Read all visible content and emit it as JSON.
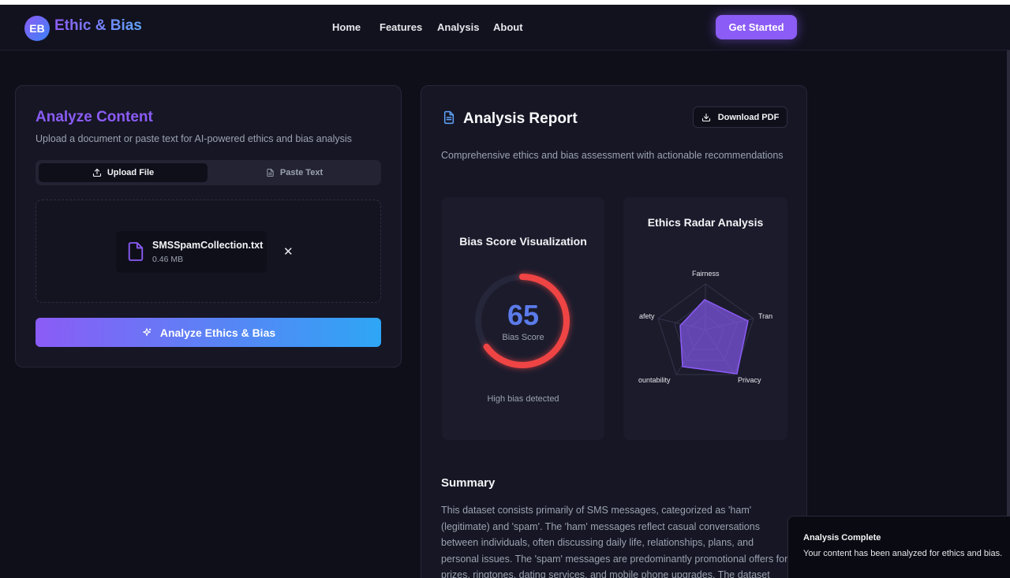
{
  "nav": {
    "logo_initials": "EB",
    "logo_text": "Ethic & Bias",
    "links": [
      "Home",
      "Features",
      "Analysis",
      "About"
    ],
    "cta": "Get Started"
  },
  "analyze": {
    "title": "Analyze Content",
    "subtitle": "Upload a document or paste text for AI-powered ethics and bias analysis",
    "tabs": [
      {
        "label": "Upload File",
        "icon": "upload-icon",
        "active": true
      },
      {
        "label": "Paste Text",
        "icon": "file-text-icon",
        "active": false
      }
    ],
    "file": {
      "name": "SMSSpamCollection.txt",
      "size": "0.46 MB",
      "remove_icon": "close-icon"
    },
    "button": "Analyze Ethics & Bias"
  },
  "report": {
    "title": "Analysis Report",
    "download": "Download PDF",
    "subtitle": "Comprehensive ethics and bias assessment with actionable recommendations",
    "bias": {
      "title": "Bias Score Visualization",
      "score": "65",
      "score_value": 65,
      "label": "Bias Score",
      "note": "High bias detected"
    },
    "radar": {
      "title": "Ethics Radar Analysis",
      "axes": [
        "Fairness",
        "Tran",
        "Privacy",
        "ountability",
        "afety"
      ]
    },
    "summary_title": "Summary",
    "summary": "This dataset consists primarily of SMS messages, categorized as 'ham' (legitimate) and 'spam'. The 'ham' messages reflect casual conversations between individuals, often discussing daily life, relationships, plans, and personal issues. The 'spam' messages are predominantly promotional offers for prizes, ringtones, dating services, and mobile phone upgrades. The dataset"
  },
  "toast": {
    "title": "Analysis Complete",
    "message": "Your content has been analyzed for ethics and bias."
  },
  "colors": {
    "accent": "#8b5cf6",
    "accent2": "#2ea6f5",
    "score": "#5b7bea",
    "gauge": "#ef4444",
    "background": "#0f0f1a"
  }
}
